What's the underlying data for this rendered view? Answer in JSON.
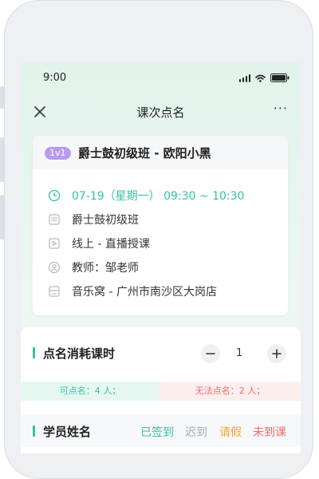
{
  "status_bar": {
    "time": "9:00"
  },
  "nav": {
    "title": "课次点名",
    "more_label": "···"
  },
  "lesson": {
    "badge": "1v1",
    "title": "爵士鼓初级班 - 欧阳小黑",
    "datetime": "07-19（星期一） 09:30 ~ 10:30",
    "class_name": "爵士鼓初级班",
    "mode": "线上 - 直播授课",
    "teacher": "教师：邹老师",
    "location": "音乐窝 - 广州市南沙区大岗店"
  },
  "consumption": {
    "title": "点名消耗课时",
    "value": "1",
    "can_call": "可点名：4 人；",
    "cannot_call": "无法点名：2 人；"
  },
  "students": {
    "title": "学员姓名",
    "legend": {
      "checked_in": "已签到",
      "late": "迟到",
      "leave": "请假",
      "absent": "未到课"
    }
  },
  "colors": {
    "accent": "#2fc4a3",
    "late": "#aaaaaa",
    "leave": "#f5a623",
    "absent": "#f06b6b",
    "badge": "#b99cf0"
  },
  "icons": [
    "close-icon",
    "more-icon",
    "signal-icon",
    "wifi-icon",
    "battery-icon",
    "clock-icon",
    "class-icon",
    "video-icon",
    "teacher-icon",
    "store-icon",
    "minus-icon",
    "plus-icon"
  ]
}
